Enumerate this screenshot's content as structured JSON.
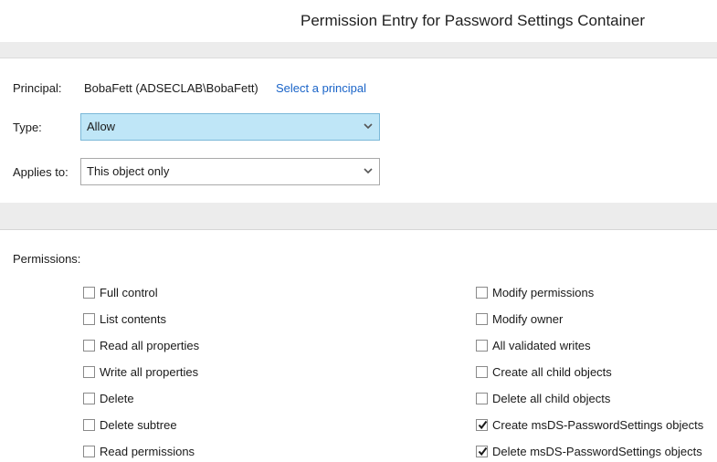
{
  "dialog": {
    "title": "Permission Entry for Password Settings Container"
  },
  "principal": {
    "label": "Principal:",
    "value": "BobaFett (ADSECLAB\\BobaFett)",
    "link": "Select a principal"
  },
  "type": {
    "label": "Type:",
    "value": "Allow"
  },
  "applies_to": {
    "label": "Applies to:",
    "value": "This object only"
  },
  "permissions": {
    "header": "Permissions:",
    "left": [
      {
        "label": "Full control",
        "checked": false
      },
      {
        "label": "List contents",
        "checked": false
      },
      {
        "label": "Read all properties",
        "checked": false
      },
      {
        "label": "Write all properties",
        "checked": false
      },
      {
        "label": "Delete",
        "checked": false
      },
      {
        "label": "Delete subtree",
        "checked": false
      },
      {
        "label": "Read permissions",
        "checked": false
      }
    ],
    "right": [
      {
        "label": "Modify permissions",
        "checked": false
      },
      {
        "label": "Modify owner",
        "checked": false
      },
      {
        "label": "All validated writes",
        "checked": false
      },
      {
        "label": "Create all child objects",
        "checked": false
      },
      {
        "label": "Delete all child objects",
        "checked": false
      },
      {
        "label": "Create msDS-PasswordSettings objects",
        "checked": true
      },
      {
        "label": "Delete msDS-PasswordSettings objects",
        "checked": true
      }
    ]
  },
  "icons": {
    "dropdown": "chevron-down-icon",
    "check": "checkmark-icon"
  },
  "colors": {
    "link": "#1a64c8",
    "selected_field": "#bfe6f7",
    "band": "#ececec"
  }
}
